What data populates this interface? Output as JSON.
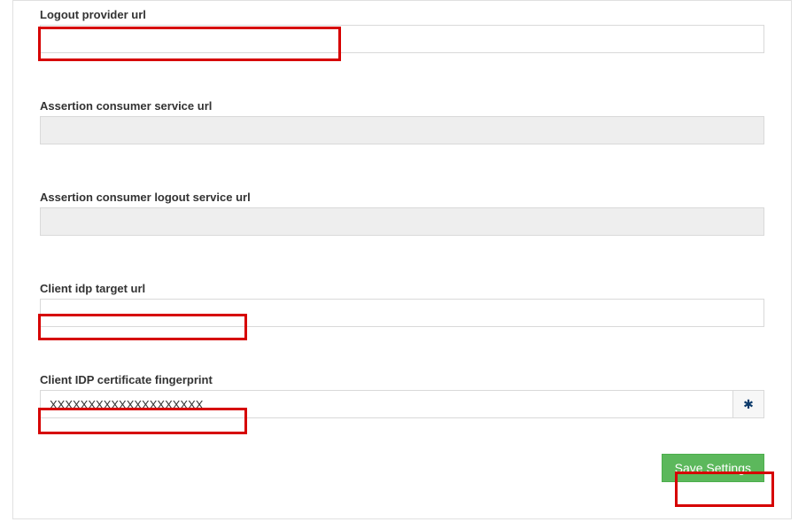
{
  "fields": {
    "logout_provider": {
      "label": "Logout provider url",
      "value": ""
    },
    "acs": {
      "label": "Assertion consumer service url",
      "value": ""
    },
    "acs_logout": {
      "label": "Assertion consumer logout service url",
      "value": ""
    },
    "client_idp_target": {
      "label": "Client idp target url",
      "value": ""
    },
    "client_idp_fp": {
      "label": "Client IDP certificate fingerprint",
      "value": "XXXXXXXXXXXXXXXXXXXX"
    }
  },
  "actions": {
    "save_label": "Save Settings"
  },
  "icons": {
    "asterisk": "✱"
  }
}
